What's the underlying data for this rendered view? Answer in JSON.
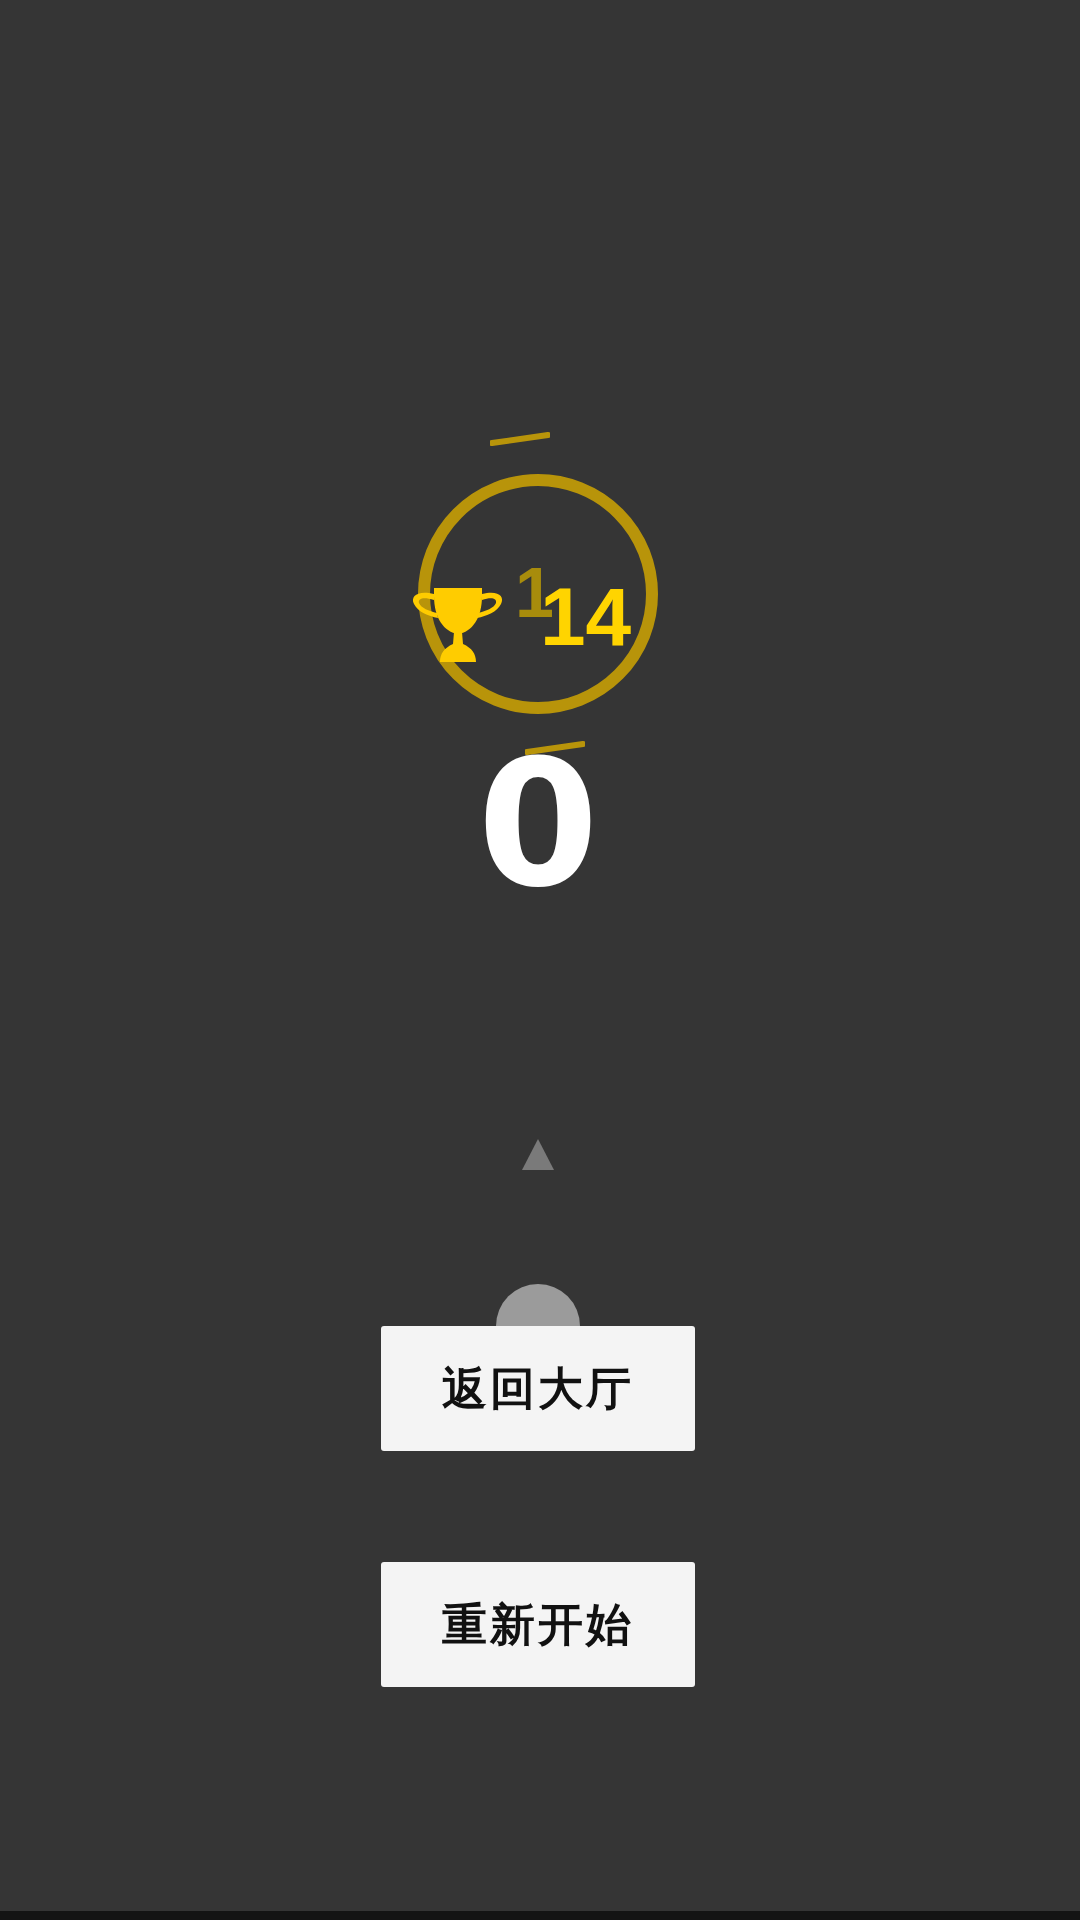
{
  "best_score": {
    "faded_digit": "1",
    "value": "14"
  },
  "score": "0",
  "buttons": [
    {
      "label": "返回大厅"
    },
    {
      "label": "重新开始"
    }
  ]
}
